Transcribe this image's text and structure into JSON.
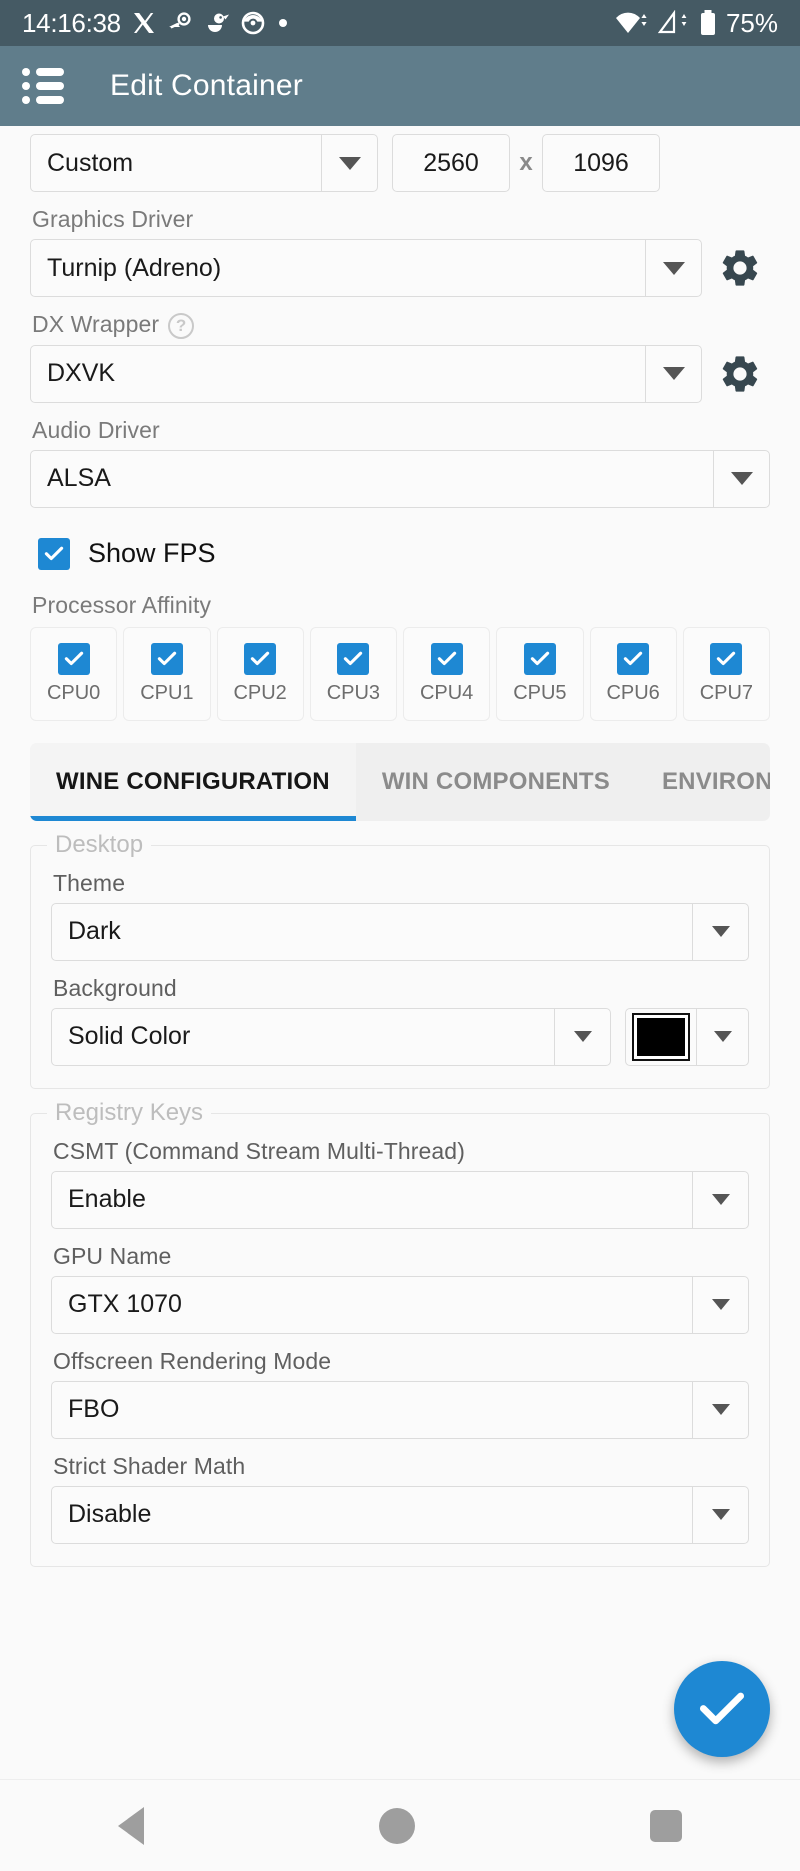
{
  "status_bar": {
    "time": "14:16:38",
    "battery_percent": "75%",
    "icons": [
      "x-app-icon",
      "steam-icon",
      "duck-icon",
      "pokeball-icon",
      "dot-icon"
    ],
    "right_icons": [
      "wifi-icon",
      "cellular-signal-icon",
      "battery-icon"
    ],
    "background_color": "#455A64"
  },
  "app_bar": {
    "title": "Edit Container",
    "menu_icon": "list-menu-icon",
    "background_color": "#607D8B"
  },
  "screen_size": {
    "preset_value": "Custom",
    "width": "2560",
    "separator": "x",
    "height": "1096"
  },
  "graphics_driver": {
    "label": "Graphics Driver",
    "value": "Turnip (Adreno)",
    "settings_icon": "gear-icon"
  },
  "dx_wrapper": {
    "label": "DX Wrapper",
    "help_icon": "help-question-icon",
    "help_glyph": "?",
    "value": "DXVK",
    "settings_icon": "gear-icon"
  },
  "audio_driver": {
    "label": "Audio Driver",
    "value": "ALSA"
  },
  "show_fps": {
    "label": "Show FPS",
    "checked": true
  },
  "processor_affinity": {
    "label": "Processor Affinity",
    "cpus": [
      {
        "label": "CPU0",
        "checked": true
      },
      {
        "label": "CPU1",
        "checked": true
      },
      {
        "label": "CPU2",
        "checked": true
      },
      {
        "label": "CPU3",
        "checked": true
      },
      {
        "label": "CPU4",
        "checked": true
      },
      {
        "label": "CPU5",
        "checked": true
      },
      {
        "label": "CPU6",
        "checked": true
      },
      {
        "label": "CPU7",
        "checked": true
      }
    ]
  },
  "tabs": {
    "active_index": 0,
    "items": [
      {
        "label": "WINE CONFIGURATION"
      },
      {
        "label": "WIN COMPONENTS"
      },
      {
        "label": "ENVIRON"
      }
    ],
    "accent_color": "#1E88D3"
  },
  "desktop_group": {
    "legend": "Desktop",
    "theme": {
      "label": "Theme",
      "value": "Dark"
    },
    "background": {
      "label": "Background",
      "value": "Solid Color",
      "color": "#000000"
    }
  },
  "registry_group": {
    "legend": "Registry Keys",
    "csmt": {
      "label": "CSMT (Command Stream Multi-Thread)",
      "value": "Enable"
    },
    "gpu_name": {
      "label": "GPU Name",
      "value": "GTX 1070"
    },
    "offscreen": {
      "label": "Offscreen Rendering Mode",
      "value": "FBO"
    },
    "strict_shader_math": {
      "label": "Strict Shader Math",
      "value": "Disable"
    }
  },
  "fab": {
    "icon": "check-icon",
    "color": "#1E88D3"
  },
  "nav_bar": {
    "back": "back-triangle-icon",
    "home": "home-circle-icon",
    "recents": "recents-square-icon"
  }
}
